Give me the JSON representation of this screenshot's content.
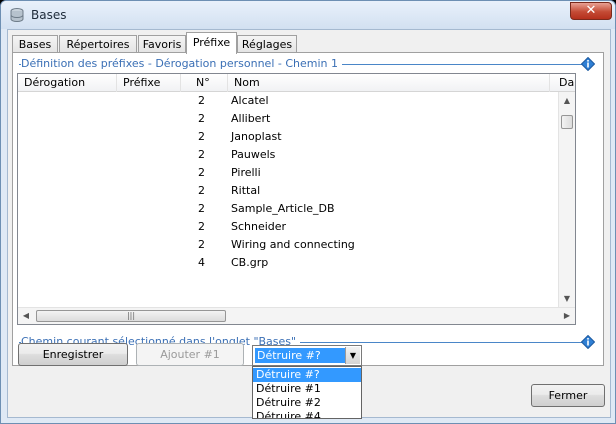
{
  "window": {
    "title": "Bases",
    "close_label": "✕"
  },
  "tabs": [
    {
      "label": "Bases",
      "active": false
    },
    {
      "label": "Répertoires",
      "active": false
    },
    {
      "label": "Favoris",
      "active": false
    },
    {
      "label": "Préfixe",
      "active": true
    },
    {
      "label": "Réglages",
      "active": false
    }
  ],
  "section_top": {
    "label": "Définition des préfixes - Dérogation personnel - Chemin 1"
  },
  "section_bottom": {
    "label": "Chemin courant sélectionné dans l'onglet \"Bases\""
  },
  "table": {
    "columns": [
      "Dérogation",
      "Préfixe",
      "N°",
      "Nom",
      "Da"
    ],
    "rows": [
      {
        "derogation": "",
        "prefixe": "",
        "n": "2",
        "nom": "Alcatel"
      },
      {
        "derogation": "",
        "prefixe": "",
        "n": "2",
        "nom": "Allibert"
      },
      {
        "derogation": "",
        "prefixe": "",
        "n": "2",
        "nom": "Janoplast"
      },
      {
        "derogation": "",
        "prefixe": "",
        "n": "2",
        "nom": "Pauwels"
      },
      {
        "derogation": "",
        "prefixe": "",
        "n": "2",
        "nom": "Pirelli"
      },
      {
        "derogation": "",
        "prefixe": "",
        "n": "2",
        "nom": "Rittal"
      },
      {
        "derogation": "",
        "prefixe": "",
        "n": "2",
        "nom": "Sample_Article_DB"
      },
      {
        "derogation": "",
        "prefixe": "",
        "n": "2",
        "nom": "Schneider"
      },
      {
        "derogation": "",
        "prefixe": "",
        "n": "2",
        "nom": "Wiring and connecting"
      },
      {
        "derogation": "",
        "prefixe": "",
        "n": "4",
        "nom": "CB.grp"
      }
    ]
  },
  "buttons": {
    "save": "Enregistrer",
    "add": "Ajouter #1",
    "close": "Fermer"
  },
  "combo": {
    "value": "Détruire #?",
    "options": [
      "Détruire #?",
      "Détruire #1",
      "Détruire #2",
      "Détruire #4"
    ],
    "selected_index": 0
  },
  "colors": {
    "accent": "#3399ff",
    "section_text": "#3a6fb5",
    "close_red": "#c44b35"
  }
}
